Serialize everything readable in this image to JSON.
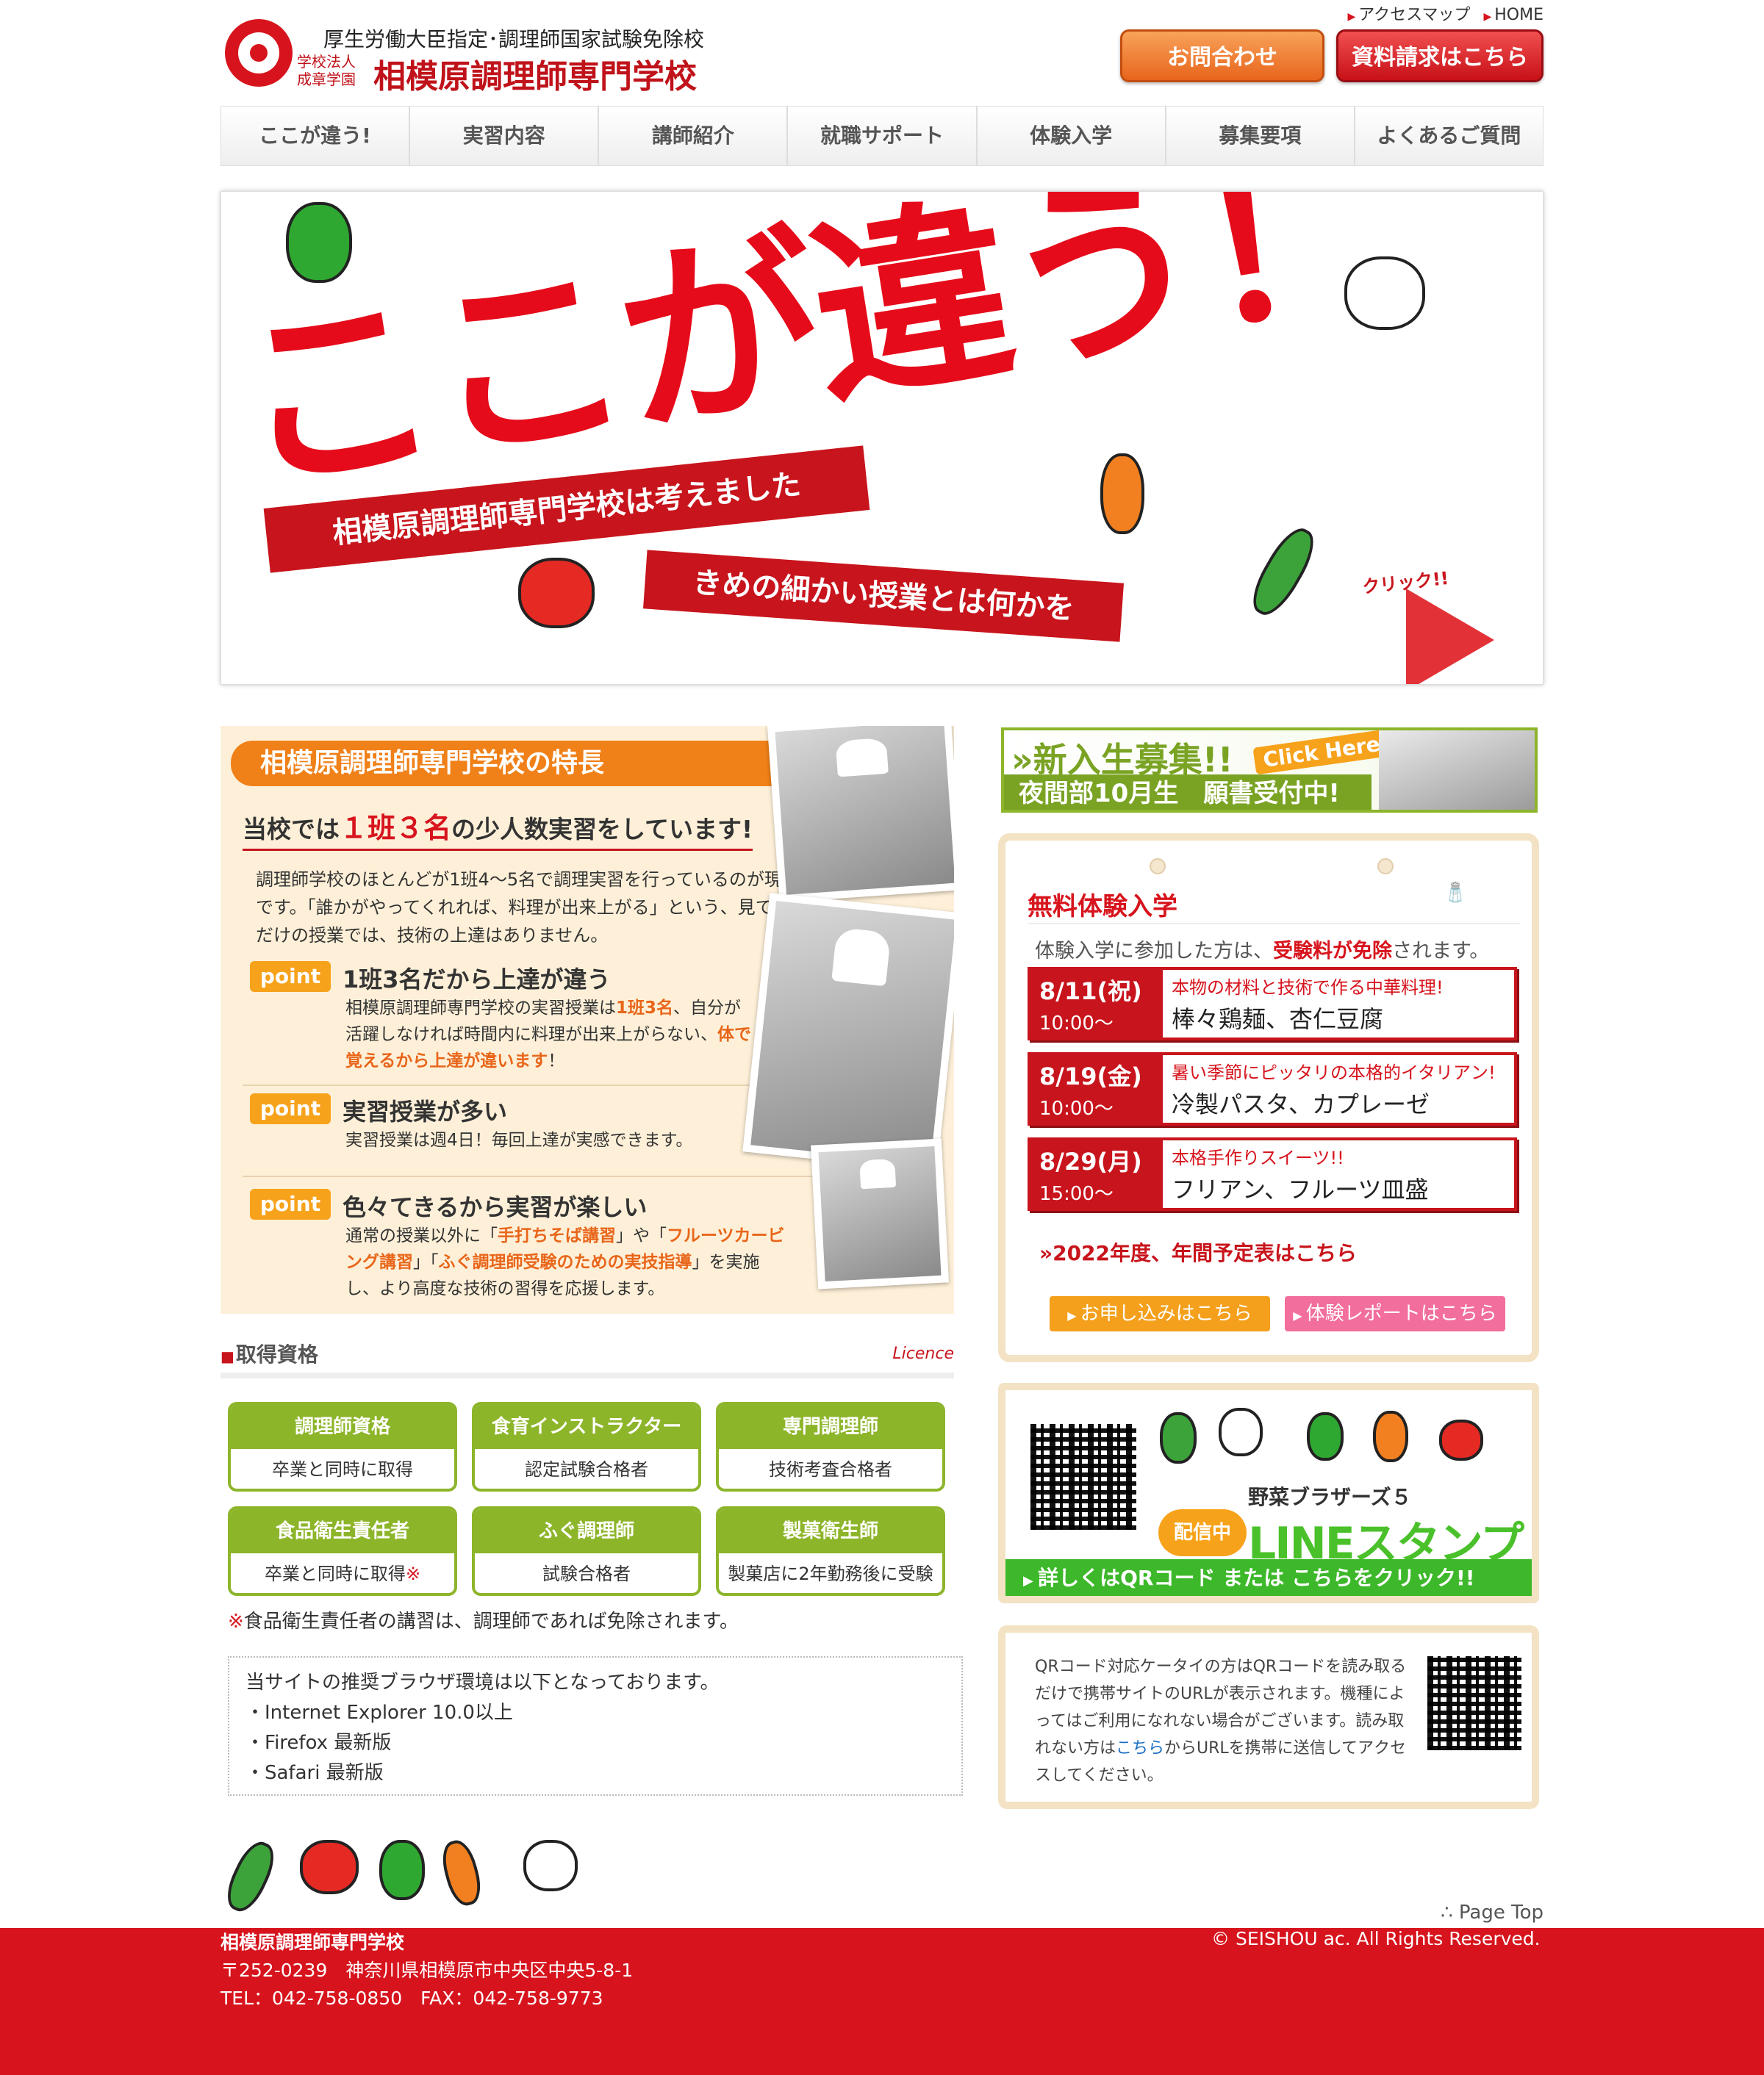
{
  "header": {
    "logo_sub": "厚生労働大臣指定･調理師国家試験免除校",
    "logo_corp_line1": "学校法人",
    "logo_corp_line2": "成章学園",
    "logo_name": "相模原調理師専門学校",
    "toplinks": [
      "アクセスマップ",
      "HOME"
    ],
    "contact_button": "お問合わせ",
    "request_button": "資料請求はこちら"
  },
  "nav": [
    "ここが違う!",
    "実習内容",
    "講師紹介",
    "就職サポート",
    "体験入学",
    "募集要項",
    "よくあるご質問"
  ],
  "hero": {
    "title": "ここが違う！",
    "band1": "相模原調理師専門学校は考えました",
    "band2": "きめの細かい授業とは何かを",
    "click": "クリック!!"
  },
  "features": {
    "heading": "相模原調理師専門学校の特長",
    "catch_pre": "当校では",
    "catch_red": "１班３名",
    "catch_post": "の少人数実習をしています!",
    "intro": "調理師学校のほとんどが1班4〜5名で調理実習を行っているのが現状です。「誰かがやってくれれば、料理が出来上がる」という、見ているだけの授業では、技術の上達はありません。",
    "badge": "point",
    "points": [
      {
        "title": "1班3名だから上達が違う",
        "body_a": "相模原調理師専門学校の実習授業は",
        "body_hl1": "1班3名",
        "body_b": "、自分が活躍しなければ時間内に料理が出来上がらない、",
        "body_hl2": "体で覚えるから上達が違います",
        "body_c": "！"
      },
      {
        "title": "実習授業が多い",
        "body_a": "実習授業は週4日！毎回上達が実感できます。"
      },
      {
        "title": "色々てきるから実習が楽しい",
        "body_a": "通常の授業以外に「",
        "body_hl1": "手打ちそば講習",
        "body_b": "」や「",
        "body_hl2": "フルーツカービング講習",
        "body_c": "」「",
        "body_hl3": "ふぐ調理師受験のための実技指導",
        "body_d": "」を実施し、より高度な技術の習得を応援します。"
      }
    ]
  },
  "licence": {
    "title": "取得資格",
    "title_en": "Licence",
    "items": [
      {
        "title": "調理師資格",
        "desc": "卒業と同時に取得"
      },
      {
        "title": "食育インストラクター",
        "desc": "認定試験合格者"
      },
      {
        "title": "専門調理師",
        "desc": "技術考査合格者"
      },
      {
        "title": "食品衛生責任者",
        "desc": "卒業と同時に取得",
        "mark": "※"
      },
      {
        "title": "ふぐ調理師",
        "desc": "試験合格者"
      },
      {
        "title": "製菓衛生師",
        "desc": "製菓店に2年勤務後に受験"
      }
    ],
    "note_mark": "※",
    "note": "食品衛生責任者の講習は、調理師であれば免除されます。"
  },
  "browser": {
    "lead": "当サイトの推奨ブラウザ環境は以下となっております。",
    "items": [
      "・Internet Explorer 10.0以上",
      "・Firefox 最新版",
      "・Safari 最新版"
    ]
  },
  "boshu": {
    "title": "»新入生募集!!",
    "click": "Click Here!",
    "bar": "夜間部10月生　願書受付中!"
  },
  "taiken": {
    "title": "無料体験入学",
    "sp_icon": "salt-pepper-icon",
    "lead_a": "体験入学に参加した方は、",
    "lead_red": "受験料が免除",
    "lead_b": "されます。",
    "events": [
      {
        "date": "8/11(祝)",
        "time": "10:00〜",
        "sub": "本物の材料と技術で作る中華料理!",
        "menu": "棒々鶏麺、杏仁豆腐"
      },
      {
        "date": "8/19(金)",
        "time": "10:00〜",
        "sub": "暑い季節にピッタリの本格的イタリアン!",
        "menu": "冷製パスタ、カプレーゼ"
      },
      {
        "date": "8/29(月)",
        "time": "15:00〜",
        "sub": "本格手作りスイーツ!!",
        "menu": "フリアン、フルーツ皿盛"
      }
    ],
    "year_link": "»2022年度、年間予定表はこちら",
    "apply": "お申し込みはこちら",
    "report": "体験レポートはこちら"
  },
  "line": {
    "title": "野菜ブラザーズ５",
    "badge": "配信中",
    "stamp": "LINEスタンプ",
    "bar": "詳しくはQRコード または こちらをクリック!!"
  },
  "qrbox": {
    "text_a": "QRコード対応ケータイの方はQRコードを読み取るだけで携帯サイトのURLが表示されます。機種によってはご利用になれない場合がございます。読み取れない方は",
    "link": "こちら",
    "text_b": "からURLを携帯に送信してアクセスしてください。"
  },
  "footer": {
    "page_top": "∴ Page Top",
    "name": "相模原調理師専門学校",
    "address": "〒252-0239　神奈川県相模原市中央区中央5-8-1",
    "tel": "TEL：042-758-0850　FAX：042-758-9773",
    "copyright": "© SEISHOU ac. All Rights Reserved."
  },
  "colors": {
    "brand_red": "#d7141d",
    "orange": "#f08018",
    "green": "#8db52a",
    "cream": "#fef0d8"
  }
}
